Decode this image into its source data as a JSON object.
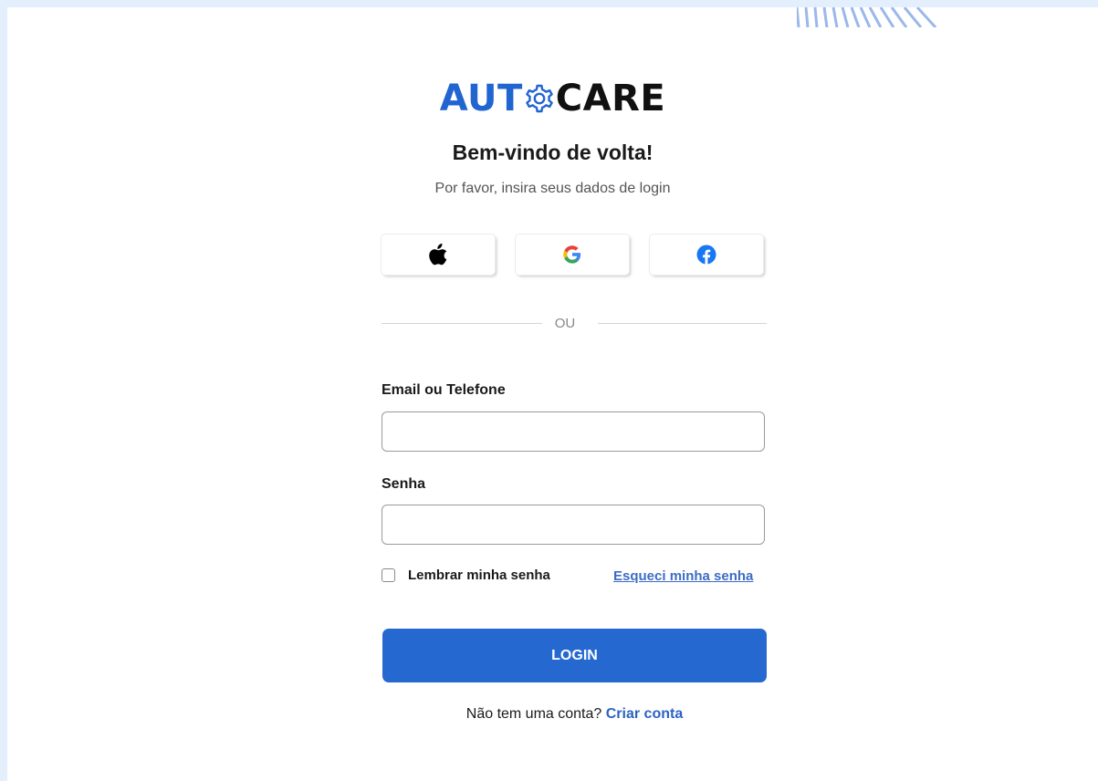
{
  "brand": {
    "logo_part1": "AUT",
    "logo_part2": "CARE",
    "primary_color": "#2165d1",
    "dark_color": "#111111"
  },
  "header": {
    "title": "Bem-vindo de volta!",
    "subtitle": "Por favor, insira seus dados de login"
  },
  "social": {
    "buttons": [
      {
        "icon": "apple-icon"
      },
      {
        "icon": "google-icon"
      },
      {
        "icon": "facebook-icon"
      }
    ]
  },
  "divider": {
    "text": "OU"
  },
  "form": {
    "email_label": "Email ou Telefone",
    "email_value": "",
    "password_label": "Senha",
    "password_value": "",
    "remember_label": "Lembrar minha senha",
    "remember_checked": false,
    "forgot_label": "Esqueci minha senha",
    "login_label": "LOGIN",
    "login_color": "#2569d0"
  },
  "signup": {
    "prompt": "Não tem uma conta?",
    "link": "Criar conta"
  }
}
